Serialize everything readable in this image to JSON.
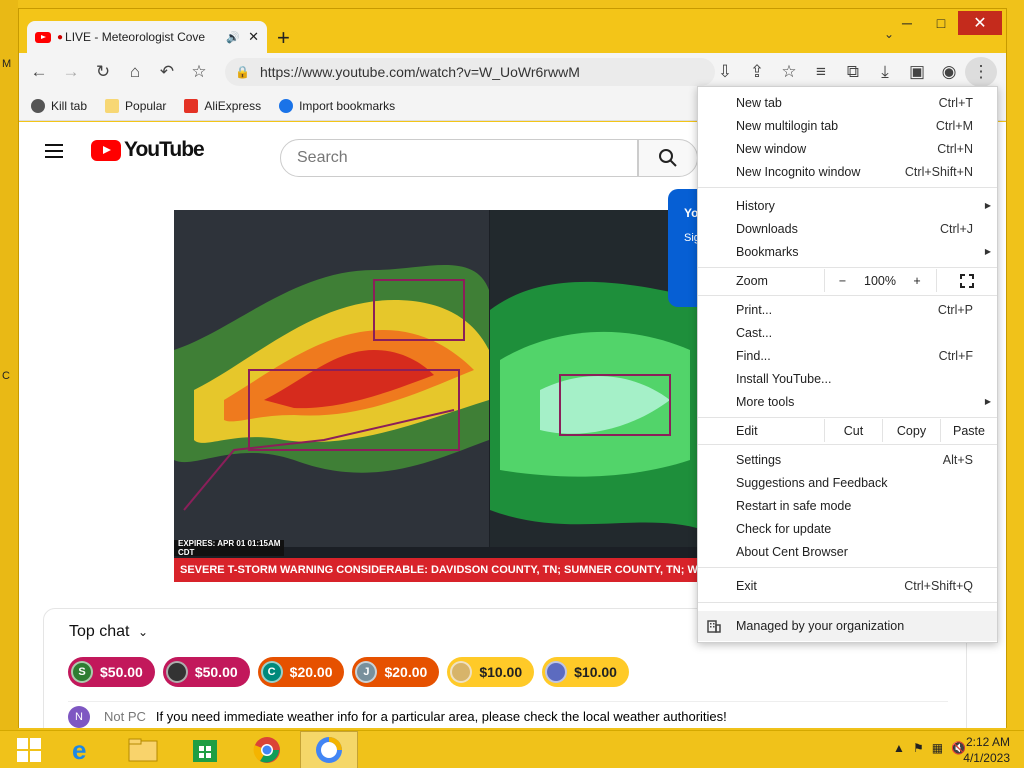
{
  "desktop": {
    "edge_labels": [
      "M",
      "C"
    ]
  },
  "window": {
    "minimize": "─",
    "maximize": "□",
    "close": "✕"
  },
  "tab": {
    "title": "LIVE - Meteorologist Cove",
    "close": "✕"
  },
  "tabstrip": {
    "new_tab": "+",
    "tab_search": "⌄"
  },
  "toolbar": {
    "url": "https://www.youtube.com/watch?v=W_UoWr6rwwM"
  },
  "bookmarks": [
    {
      "label": "Kill tab",
      "icon": "globe-icon",
      "color": "#555555"
    },
    {
      "label": "Popular",
      "icon": "folder-icon",
      "color": "#f7d774"
    },
    {
      "label": "AliExpress",
      "icon": "aliexpress-icon",
      "color": "#e43225"
    },
    {
      "label": "Import bookmarks",
      "icon": "gear-icon",
      "color": "#1a73e8"
    }
  ],
  "youtube": {
    "logo_text": "YouTube",
    "search_placeholder": "Search",
    "signin_card_text": "Yo",
    "signin_card_sub": "Sig"
  },
  "video": {
    "expires": "EXPIRES: APR 01 01:15AM CDT",
    "banner": "SEVERE T-STORM WARNING    CONSIDERABLE: DAVIDSON COUNTY, TN; SUMNER COUNTY, TN; WILSON COUNTY, TN"
  },
  "chat": {
    "title": "Top chat",
    "chips": [
      {
        "initial": "S",
        "amount": "$50.00",
        "bg": "#c2185b",
        "av": "#2e7d32"
      },
      {
        "initial": "",
        "amount": "$50.00",
        "bg": "#c2185b",
        "av": "#333333"
      },
      {
        "initial": "C",
        "amount": "$20.00",
        "bg": "#e65100",
        "av": "#00897b"
      },
      {
        "initial": "J",
        "amount": "$20.00",
        "bg": "#e65100",
        "av": "#78909c"
      },
      {
        "initial": "",
        "amount": "$10.00",
        "bg": "#ffca28",
        "av": "#d7b46a",
        "dark": true
      },
      {
        "initial": "",
        "amount": "$10.00",
        "bg": "#ffca28",
        "av": "#5c6bc0",
        "dark": true
      }
    ],
    "message": {
      "initial": "N",
      "author": "Not PC",
      "text": "If you need immediate weather info for a particular area, please check the local weather authorities!"
    }
  },
  "menu": {
    "new_tab": {
      "label": "New tab",
      "shortcut": "Ctrl+T"
    },
    "new_multilogin": {
      "label": "New multilogin tab",
      "shortcut": "Ctrl+M"
    },
    "new_window": {
      "label": "New window",
      "shortcut": "Ctrl+N"
    },
    "new_incognito": {
      "label": "New Incognito window",
      "shortcut": "Ctrl+Shift+N"
    },
    "history": {
      "label": "History"
    },
    "downloads": {
      "label": "Downloads",
      "shortcut": "Ctrl+J"
    },
    "bookmarks": {
      "label": "Bookmarks"
    },
    "zoom": {
      "label": "Zoom",
      "minus": "−",
      "level": "100%",
      "plus": "+"
    },
    "print": {
      "label": "Print...",
      "shortcut": "Ctrl+P"
    },
    "cast": {
      "label": "Cast..."
    },
    "find": {
      "label": "Find...",
      "shortcut": "Ctrl+F"
    },
    "install": {
      "label": "Install YouTube..."
    },
    "more_tools": {
      "label": "More tools"
    },
    "edit": {
      "label": "Edit",
      "cut": "Cut",
      "copy": "Copy",
      "paste": "Paste"
    },
    "settings": {
      "label": "Settings",
      "shortcut": "Alt+S"
    },
    "suggestions": {
      "label": "Suggestions and Feedback"
    },
    "safe_mode": {
      "label": "Restart in safe mode"
    },
    "update": {
      "label": "Check for update"
    },
    "about": {
      "label": "About Cent Browser"
    },
    "exit": {
      "label": "Exit",
      "shortcut": "Ctrl+Shift+Q"
    },
    "managed": {
      "label": "Managed by your organization"
    }
  },
  "taskbar": {
    "apps": [
      "start-button",
      "internet-explorer-icon",
      "file-explorer-icon",
      "store-icon",
      "chrome-icon",
      "cent-browser-icon"
    ],
    "tray": [
      "▲",
      "⚑",
      "▦",
      "🔇"
    ],
    "time": "2:12 AM",
    "date": "4/1/2023"
  },
  "colors": {
    "desktop": "#f0c21a",
    "youtube_red": "#ff0000",
    "accent_blue": "#065fd4"
  }
}
